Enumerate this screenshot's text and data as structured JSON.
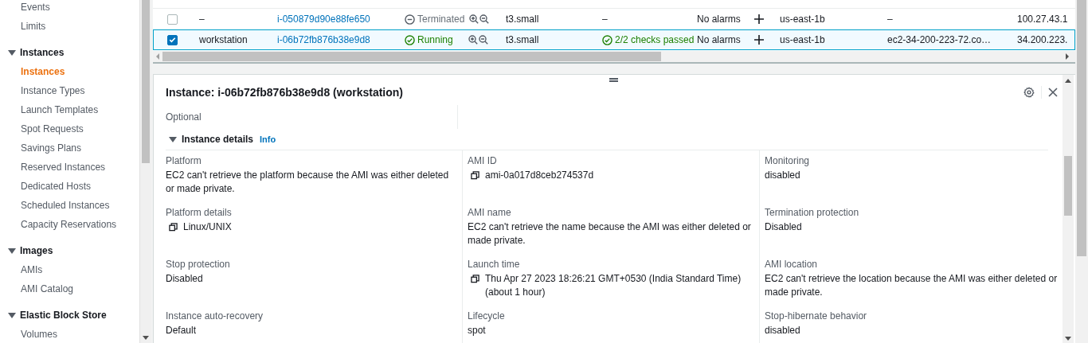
{
  "sidebar": {
    "sections": [
      {
        "items": [
          {
            "label": "Events",
            "selected": false
          },
          {
            "label": "Limits",
            "selected": false
          }
        ]
      },
      {
        "title": "Instances",
        "expanded": true,
        "items": [
          {
            "label": "Instances",
            "selected": true
          },
          {
            "label": "Instance Types",
            "selected": false
          },
          {
            "label": "Launch Templates",
            "selected": false
          },
          {
            "label": "Spot Requests",
            "selected": false
          },
          {
            "label": "Savings Plans",
            "selected": false
          },
          {
            "label": "Reserved Instances",
            "selected": false
          },
          {
            "label": "Dedicated Hosts",
            "selected": false
          },
          {
            "label": "Scheduled Instances",
            "selected": false
          },
          {
            "label": "Capacity Reservations",
            "selected": false
          }
        ]
      },
      {
        "title": "Images",
        "expanded": true,
        "items": [
          {
            "label": "AMIs",
            "selected": false
          },
          {
            "label": "AMI Catalog",
            "selected": false
          }
        ]
      },
      {
        "title": "Elastic Block Store",
        "expanded": true,
        "items": [
          {
            "label": "Volumes",
            "selected": false
          }
        ]
      }
    ]
  },
  "table": {
    "rows": [
      {
        "checked": false,
        "selected": false,
        "name": "–",
        "instance_id": "i-050879d90e88fe650",
        "state": {
          "kind": "terminated",
          "label": "Terminated"
        },
        "type": "t3.small",
        "status_check": "–",
        "alarms": "No alarms",
        "az": "us-east-1b",
        "dns": "–",
        "ip": "100.27.43.1"
      },
      {
        "checked": true,
        "selected": true,
        "name": "workstation",
        "instance_id": "i-06b72fb876b38e9d8",
        "state": {
          "kind": "running",
          "label": "Running"
        },
        "type": "t3.small",
        "status_check": "2/2 checks passed",
        "alarms": "No alarms",
        "az": "us-east-1b",
        "dns": "ec2-34-200-223-72.co…",
        "ip": "34.200.223."
      }
    ]
  },
  "detail": {
    "title": "Instance: i-06b72fb876b38e9d8 (workstation)",
    "cut_label": "Optional",
    "section": {
      "title": "Instance details",
      "expanded": true,
      "info": "Info"
    },
    "fields": [
      {
        "label": "Platform",
        "value": "EC2 can't retrieve the platform because the AMI was either deleted or made private.",
        "copyable": false
      },
      {
        "label": "AMI ID",
        "value": "ami-0a017d8ceb274537d",
        "copyable": true
      },
      {
        "label": "Monitoring",
        "value": "disabled",
        "copyable": false
      },
      {
        "label": "Platform details",
        "value": "Linux/UNIX",
        "copyable": true
      },
      {
        "label": "AMI name",
        "value": "EC2 can't retrieve the name because the AMI was either deleted or made private.",
        "copyable": false
      },
      {
        "label": "Termination protection",
        "value": "Disabled",
        "copyable": false
      },
      {
        "label": "Stop protection",
        "value": "Disabled",
        "copyable": false
      },
      {
        "label": "Launch time",
        "value": "Thu Apr 27 2023 18:26:21 GMT+0530 (India Standard Time) (about 1 hour)",
        "copyable": true
      },
      {
        "label": "AMI location",
        "value": "EC2 can't retrieve the location because the AMI was either deleted or made private.",
        "copyable": false
      },
      {
        "label": "Instance auto-recovery",
        "value": "Default",
        "copyable": false
      },
      {
        "label": "Lifecycle",
        "value": "spot",
        "copyable": false
      },
      {
        "label": "Stop-hibernate behavior",
        "value": "disabled",
        "copyable": false
      }
    ]
  }
}
